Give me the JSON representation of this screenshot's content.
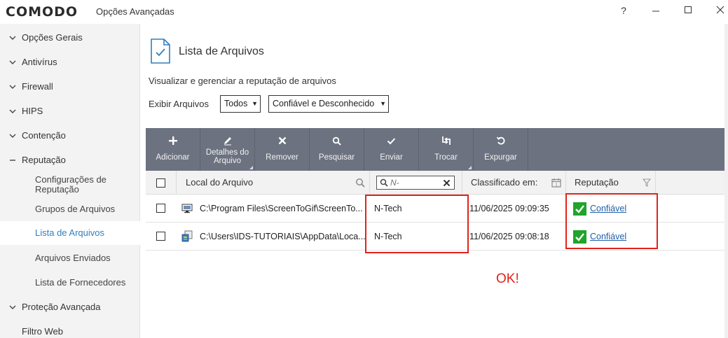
{
  "app": {
    "brand": "COMODO",
    "window_title": "Opções Avançadas"
  },
  "window_controls": {
    "help": "?",
    "minimize": "—",
    "maximize": "☐",
    "close": "✕"
  },
  "sidebar": {
    "items": [
      {
        "label": "Opções Gerais",
        "chevron": "⌄"
      },
      {
        "label": "Antivírus",
        "chevron": "⌄"
      },
      {
        "label": "Firewall",
        "chevron": "⌄"
      },
      {
        "label": "HIPS",
        "chevron": "⌄"
      },
      {
        "label": "Contenção",
        "chevron": "⌄"
      },
      {
        "label": "Reputação",
        "chevron": "—"
      }
    ],
    "sub_items": [
      {
        "label": "Configurações de Reputação"
      },
      {
        "label": "Grupos de Arquivos"
      },
      {
        "label": "Lista de Arquivos"
      },
      {
        "label": "Arquivos Enviados"
      },
      {
        "label": "Lista de Fornecedores"
      }
    ],
    "after_items": [
      {
        "label": "Proteção Avançada",
        "chevron": "⌄"
      },
      {
        "label": "Filtro Web"
      }
    ]
  },
  "main": {
    "title": "Lista de Arquivos",
    "description": "Visualizar e gerenciar a reputação de arquivos",
    "filter_label": "Exibir Arquivos",
    "filter_type": "Todos",
    "filter_reputation": "Confiável e Desconhecido"
  },
  "toolbar": {
    "buttons": [
      {
        "label": "Adicionar",
        "icon": "plus-icon"
      },
      {
        "label": "Detalhes do Arquivo",
        "label_line1": "Detalhes do",
        "label_line2": "Arquivo",
        "icon": "pencil-icon"
      },
      {
        "label": "Remover",
        "icon": "x-icon"
      },
      {
        "label": "Pesquisar",
        "icon": "search-icon"
      },
      {
        "label": "Enviar",
        "icon": "check-icon"
      },
      {
        "label": "Trocar",
        "icon": "swap-icon"
      },
      {
        "label": "Expurgar",
        "icon": "refresh-icon"
      }
    ]
  },
  "table": {
    "columns": {
      "path": "Local do Arquivo",
      "vendor_placeholder": "N-",
      "classified": "Classificado em:",
      "reputation": "Reputação"
    },
    "rows": [
      {
        "path": "C:\\Program Files\\ScreenToGif\\ScreenTo...",
        "vendor": "N-Tech",
        "date": "11/06/2025 09:09:35",
        "reputation": "Confiável",
        "icon": "monitor-app-icon"
      },
      {
        "path": "C:\\Users\\IDS-TUTORIAIS\\AppData\\Loca...",
        "vendor": "N-Tech",
        "date": "11/06/2025 09:08:18",
        "reputation": "Confiável",
        "icon": "installer-app-icon"
      }
    ]
  },
  "annotation": {
    "text": "OK!",
    "color": "#e2231a"
  },
  "colors": {
    "toolbar": "#6c7280",
    "accent_link": "#2f7fc0",
    "trusted": "#1ea52a",
    "highlight": "#e2231a"
  }
}
